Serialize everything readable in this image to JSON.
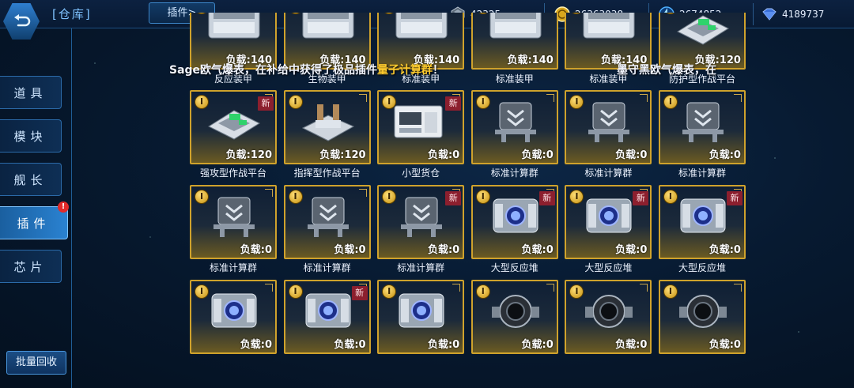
{
  "header": {
    "title": "[仓库]",
    "crumb": "插件>"
  },
  "resources": [
    {
      "icon": "ore-icon",
      "value": "42325"
    },
    {
      "icon": "gold-coin-icon",
      "value": "26363038"
    },
    {
      "icon": "energy-icon",
      "value": "2674852"
    },
    {
      "icon": "crystal-icon",
      "value": "4189737"
    }
  ],
  "sidebar": {
    "items": [
      {
        "label": "道具"
      },
      {
        "label": "模块"
      },
      {
        "label": "舰长"
      },
      {
        "label": "插件",
        "badge": "!"
      },
      {
        "label": "芯片"
      }
    ],
    "recycle_label": "批量回收"
  },
  "broadcast": {
    "msg1_prefix": "Sage欧气爆表，在补给中获得了极品插件",
    "msg1_item": "量子计算群",
    "msg1_suffix": "！",
    "msg2": "墨守黑欧气爆表，在"
  },
  "colors": {
    "card_border": "#cfa22c",
    "highlight": "#ffcc2e",
    "new_tag": "#8c1f2e",
    "active_tab": "#2a82d1"
  },
  "grid": {
    "items": [
      {
        "name": "反应装甲",
        "load": "负载:140",
        "level": "I",
        "new": false,
        "art": "armor"
      },
      {
        "name": "生物装甲",
        "load": "负载:140",
        "level": "I",
        "new": false,
        "art": "armor"
      },
      {
        "name": "标准装甲",
        "load": "负载:140",
        "level": "I",
        "new": false,
        "art": "armor"
      },
      {
        "name": "标准装甲",
        "load": "负载:140",
        "level": "I",
        "new": false,
        "art": "armor"
      },
      {
        "name": "标准装甲",
        "load": "负载:140",
        "level": "I",
        "new": false,
        "art": "armor"
      },
      {
        "name": "防护型作战平台",
        "load": "负载:120",
        "level": "I",
        "new": false,
        "art": "platform"
      },
      {
        "name": "强攻型作战平台",
        "load": "负载:120",
        "level": "I",
        "new": true,
        "new_label": "新",
        "art": "platform"
      },
      {
        "name": "指挥型作战平台",
        "load": "负载:120",
        "level": "I",
        "new": false,
        "art": "platform2"
      },
      {
        "name": "小型货仓",
        "load": "负载:0",
        "level": "I",
        "new": true,
        "new_label": "新",
        "art": "cargo"
      },
      {
        "name": "标准计算群",
        "load": "负载:0",
        "level": "I",
        "new": false,
        "art": "compute"
      },
      {
        "name": "标准计算群",
        "load": "负载:0",
        "level": "I",
        "new": false,
        "art": "compute"
      },
      {
        "name": "标准计算群",
        "load": "负载:0",
        "level": "I",
        "new": false,
        "art": "compute"
      },
      {
        "name": "标准计算群",
        "load": "负载:0",
        "level": "I",
        "new": false,
        "art": "compute"
      },
      {
        "name": "标准计算群",
        "load": "负载:0",
        "level": "I",
        "new": false,
        "art": "compute"
      },
      {
        "name": "标准计算群",
        "load": "负载:0",
        "level": "I",
        "new": true,
        "new_label": "新",
        "art": "compute"
      },
      {
        "name": "大型反应堆",
        "load": "负载:0",
        "level": "I",
        "new": true,
        "new_label": "新",
        "art": "reactor"
      },
      {
        "name": "大型反应堆",
        "load": "负载:0",
        "level": "I",
        "new": true,
        "new_label": "新",
        "art": "reactor"
      },
      {
        "name": "大型反应堆",
        "load": "负载:0",
        "level": "I",
        "new": true,
        "new_label": "新",
        "art": "reactor"
      },
      {
        "name": "",
        "load": "负载:0",
        "level": "I",
        "new": false,
        "art": "reactor"
      },
      {
        "name": "",
        "load": "负载:0",
        "level": "I",
        "new": true,
        "new_label": "新",
        "art": "reactor"
      },
      {
        "name": "",
        "load": "负载:0",
        "level": "I",
        "new": false,
        "art": "reactor"
      },
      {
        "name": "",
        "load": "负载:0",
        "level": "I",
        "new": false,
        "art": "engine"
      },
      {
        "name": "",
        "load": "负载:0",
        "level": "I",
        "new": false,
        "art": "engine"
      },
      {
        "name": "",
        "load": "负载:0",
        "level": "I",
        "new": false,
        "art": "engine"
      }
    ]
  }
}
